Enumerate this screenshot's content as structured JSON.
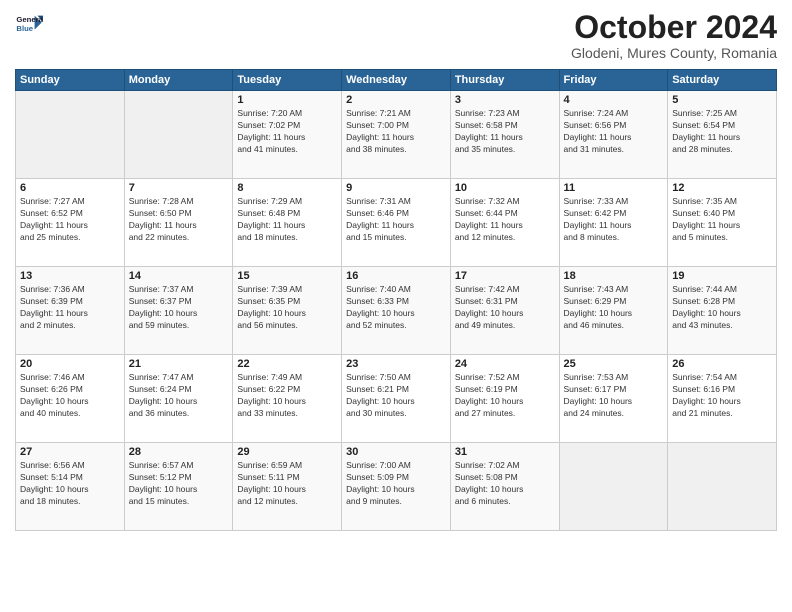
{
  "logo": {
    "line1": "General",
    "line2": "Blue"
  },
  "title": "October 2024",
  "location": "Glodeni, Mures County, Romania",
  "weekdays": [
    "Sunday",
    "Monday",
    "Tuesday",
    "Wednesday",
    "Thursday",
    "Friday",
    "Saturday"
  ],
  "weeks": [
    [
      {
        "day": "",
        "info": ""
      },
      {
        "day": "",
        "info": ""
      },
      {
        "day": "1",
        "info": "Sunrise: 7:20 AM\nSunset: 7:02 PM\nDaylight: 11 hours\nand 41 minutes."
      },
      {
        "day": "2",
        "info": "Sunrise: 7:21 AM\nSunset: 7:00 PM\nDaylight: 11 hours\nand 38 minutes."
      },
      {
        "day": "3",
        "info": "Sunrise: 7:23 AM\nSunset: 6:58 PM\nDaylight: 11 hours\nand 35 minutes."
      },
      {
        "day": "4",
        "info": "Sunrise: 7:24 AM\nSunset: 6:56 PM\nDaylight: 11 hours\nand 31 minutes."
      },
      {
        "day": "5",
        "info": "Sunrise: 7:25 AM\nSunset: 6:54 PM\nDaylight: 11 hours\nand 28 minutes."
      }
    ],
    [
      {
        "day": "6",
        "info": "Sunrise: 7:27 AM\nSunset: 6:52 PM\nDaylight: 11 hours\nand 25 minutes."
      },
      {
        "day": "7",
        "info": "Sunrise: 7:28 AM\nSunset: 6:50 PM\nDaylight: 11 hours\nand 22 minutes."
      },
      {
        "day": "8",
        "info": "Sunrise: 7:29 AM\nSunset: 6:48 PM\nDaylight: 11 hours\nand 18 minutes."
      },
      {
        "day": "9",
        "info": "Sunrise: 7:31 AM\nSunset: 6:46 PM\nDaylight: 11 hours\nand 15 minutes."
      },
      {
        "day": "10",
        "info": "Sunrise: 7:32 AM\nSunset: 6:44 PM\nDaylight: 11 hours\nand 12 minutes."
      },
      {
        "day": "11",
        "info": "Sunrise: 7:33 AM\nSunset: 6:42 PM\nDaylight: 11 hours\nand 8 minutes."
      },
      {
        "day": "12",
        "info": "Sunrise: 7:35 AM\nSunset: 6:40 PM\nDaylight: 11 hours\nand 5 minutes."
      }
    ],
    [
      {
        "day": "13",
        "info": "Sunrise: 7:36 AM\nSunset: 6:39 PM\nDaylight: 11 hours\nand 2 minutes."
      },
      {
        "day": "14",
        "info": "Sunrise: 7:37 AM\nSunset: 6:37 PM\nDaylight: 10 hours\nand 59 minutes."
      },
      {
        "day": "15",
        "info": "Sunrise: 7:39 AM\nSunset: 6:35 PM\nDaylight: 10 hours\nand 56 minutes."
      },
      {
        "day": "16",
        "info": "Sunrise: 7:40 AM\nSunset: 6:33 PM\nDaylight: 10 hours\nand 52 minutes."
      },
      {
        "day": "17",
        "info": "Sunrise: 7:42 AM\nSunset: 6:31 PM\nDaylight: 10 hours\nand 49 minutes."
      },
      {
        "day": "18",
        "info": "Sunrise: 7:43 AM\nSunset: 6:29 PM\nDaylight: 10 hours\nand 46 minutes."
      },
      {
        "day": "19",
        "info": "Sunrise: 7:44 AM\nSunset: 6:28 PM\nDaylight: 10 hours\nand 43 minutes."
      }
    ],
    [
      {
        "day": "20",
        "info": "Sunrise: 7:46 AM\nSunset: 6:26 PM\nDaylight: 10 hours\nand 40 minutes."
      },
      {
        "day": "21",
        "info": "Sunrise: 7:47 AM\nSunset: 6:24 PM\nDaylight: 10 hours\nand 36 minutes."
      },
      {
        "day": "22",
        "info": "Sunrise: 7:49 AM\nSunset: 6:22 PM\nDaylight: 10 hours\nand 33 minutes."
      },
      {
        "day": "23",
        "info": "Sunrise: 7:50 AM\nSunset: 6:21 PM\nDaylight: 10 hours\nand 30 minutes."
      },
      {
        "day": "24",
        "info": "Sunrise: 7:52 AM\nSunset: 6:19 PM\nDaylight: 10 hours\nand 27 minutes."
      },
      {
        "day": "25",
        "info": "Sunrise: 7:53 AM\nSunset: 6:17 PM\nDaylight: 10 hours\nand 24 minutes."
      },
      {
        "day": "26",
        "info": "Sunrise: 7:54 AM\nSunset: 6:16 PM\nDaylight: 10 hours\nand 21 minutes."
      }
    ],
    [
      {
        "day": "27",
        "info": "Sunrise: 6:56 AM\nSunset: 5:14 PM\nDaylight: 10 hours\nand 18 minutes."
      },
      {
        "day": "28",
        "info": "Sunrise: 6:57 AM\nSunset: 5:12 PM\nDaylight: 10 hours\nand 15 minutes."
      },
      {
        "day": "29",
        "info": "Sunrise: 6:59 AM\nSunset: 5:11 PM\nDaylight: 10 hours\nand 12 minutes."
      },
      {
        "day": "30",
        "info": "Sunrise: 7:00 AM\nSunset: 5:09 PM\nDaylight: 10 hours\nand 9 minutes."
      },
      {
        "day": "31",
        "info": "Sunrise: 7:02 AM\nSunset: 5:08 PM\nDaylight: 10 hours\nand 6 minutes."
      },
      {
        "day": "",
        "info": ""
      },
      {
        "day": "",
        "info": ""
      }
    ]
  ]
}
